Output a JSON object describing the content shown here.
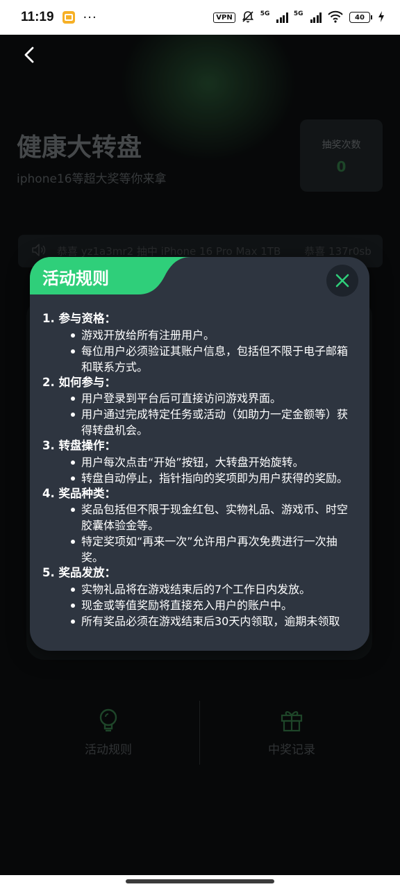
{
  "status_bar": {
    "time": "11:19",
    "dots": "···",
    "vpn": "VPN",
    "net1": "5G",
    "net2": "5G",
    "battery": "40"
  },
  "hero": {
    "title": "健康大转盘",
    "subtitle": "iphone16等超大奖等你来拿",
    "draw_count_label": "抽奖次数",
    "draw_count_value": "0"
  },
  "ticker": {
    "items": [
      "恭喜 yz1a3mr2 抽中 iPhone 16 Pro Max 1TB",
      "恭喜 137r0sb"
    ]
  },
  "modal": {
    "title": "活动规则",
    "sections": [
      {
        "heading": "1. 参与资格：",
        "items": [
          "游戏开放给所有注册用户。",
          "每位用户必须验证其账户信息，包括但不限于电子邮箱和联系方式。"
        ]
      },
      {
        "heading": "2. 如何参与：",
        "items": [
          "用户登录到平台后可直接访问游戏界面。",
          "用户通过完成特定任务或活动（如助力一定金额等）获得转盘机会。"
        ]
      },
      {
        "heading": "3. 转盘操作：",
        "items": [
          "用户每次点击“开始”按钮，大转盘开始旋转。",
          "转盘自动停止，指针指向的奖项即为用户获得的奖励。"
        ]
      },
      {
        "heading": "4. 奖品种类：",
        "items": [
          "奖品包括但不限于现金红包、实物礼品、游戏币、时空胶囊体验金等。",
          "特定奖项如“再来一次”允许用户再次免费进行一次抽奖。"
        ]
      },
      {
        "heading": "5. 奖品发放：",
        "items": [
          "实物礼品将在游戏结束后的7个工作日内发放。",
          "现金或等值奖励将直接充入用户的账户中。",
          "所有奖品必须在游戏结束后30天内领取，逾期未领取"
        ]
      }
    ]
  },
  "bottom_nav": {
    "rules_label": "活动规则",
    "records_label": "中奖记录"
  },
  "colors": {
    "accent_green": "#2fcf7a",
    "modal_bg": "#2e3540",
    "page_bg": "#0b0d0e"
  }
}
